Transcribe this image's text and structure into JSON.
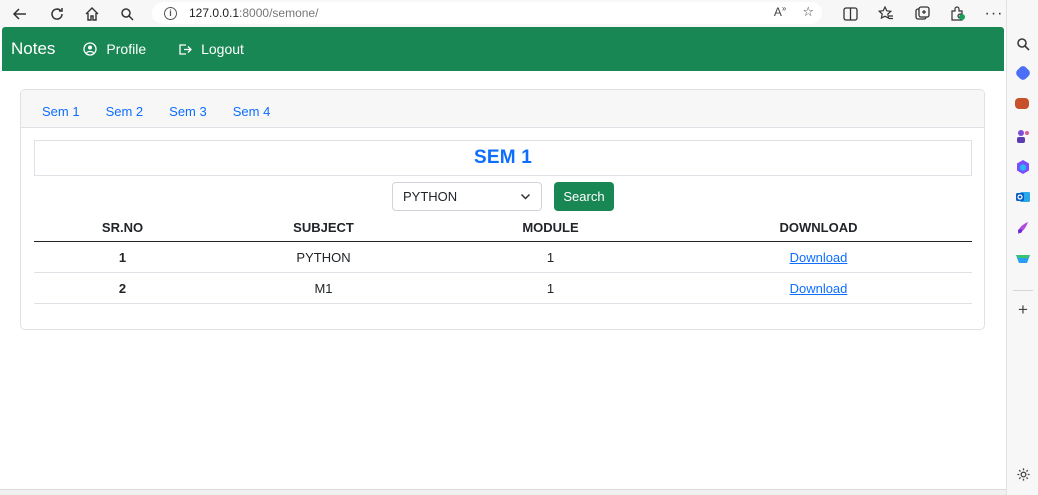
{
  "browser": {
    "url_host": "127.0.0.1",
    "url_path": ":8000/semone/"
  },
  "navbar": {
    "brand": "Notes",
    "profile_label": "Profile",
    "logout_label": "Logout"
  },
  "tabs": [
    "Sem 1",
    "Sem 2",
    "Sem 3",
    "Sem 4"
  ],
  "page_title": "SEM 1",
  "filter": {
    "selected_subject": "PYTHON",
    "search_label": "Search"
  },
  "table": {
    "headers": [
      "SR.NO",
      "SUBJECT",
      "MODULE",
      "DOWNLOAD"
    ],
    "rows": [
      {
        "sr_no": "1",
        "subject": "PYTHON",
        "module": "1",
        "download": "Download"
      },
      {
        "sr_no": "2",
        "subject": "M1",
        "module": "1",
        "download": "Download"
      }
    ]
  },
  "colors": {
    "navbar": "#198754",
    "accent_blue": "#0d6efd"
  },
  "icons": {
    "toolbar": [
      "back-icon",
      "refresh-icon",
      "home-icon",
      "search-icon"
    ],
    "toolbar_right": [
      "read-aloud-icon",
      "favorite-star-icon",
      "split-screen-icon",
      "favorites-icon",
      "collections-icon",
      "extensions-icon",
      "more-icon",
      "copilot-icon"
    ],
    "sidebar": [
      "sidebar-search-icon",
      "shopping-icon",
      "tools-icon",
      "games-icon",
      "microsoft-365-icon",
      "outlook-icon",
      "designer-icon",
      "drop-icon",
      "add-icon",
      "settings-icon"
    ]
  }
}
